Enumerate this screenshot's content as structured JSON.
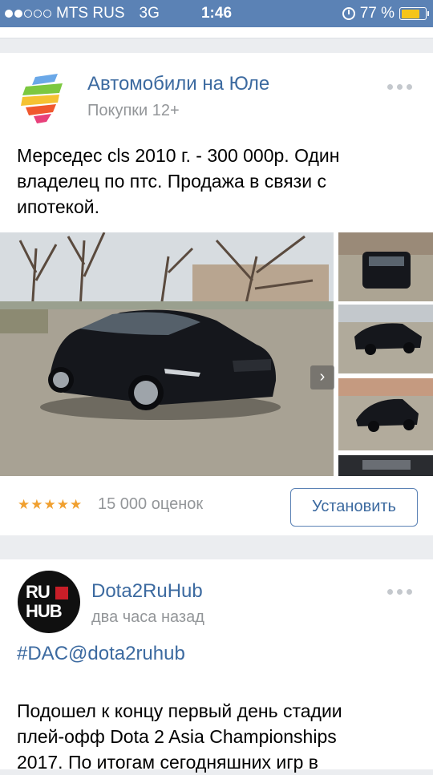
{
  "status_bar": {
    "carrier": "MTS RUS",
    "network": "3G",
    "time": "1:46",
    "battery_percent": "77 %",
    "battery_level": 0.77,
    "signal_dots_filled": 2,
    "signal_dots_total": 5,
    "bar_color": "#5b82b5",
    "battery_color": "#f5c518"
  },
  "feed": {
    "ad_post": {
      "group_name": "Автомобили на Юле",
      "subtitle": "Покупки 12+",
      "text_lines": [
        "Мерседес cls  2010 г. - 300 000р. Один",
        "владелец по птс. Продажа в связи с",
        "ипотекой."
      ],
      "gallery_arrow": "›",
      "rating_stars": "★★★★★",
      "rating_value": 4.5,
      "ratings_count": "15 000 оценок",
      "install_label": "Установить",
      "link_color": "#3c6aa0"
    },
    "post2": {
      "author": "Dota2RuHub",
      "time": "два часа назад",
      "avatar_text": [
        "RU",
        "HUB"
      ],
      "hashtag": "#DAC@dota2ruhub",
      "text_lines": [
        "Подошел к концу первый день стадии",
        "плей-офф Dota 2 Asia Championships",
        "2017. По итогам сегодняшних игр в"
      ]
    }
  }
}
